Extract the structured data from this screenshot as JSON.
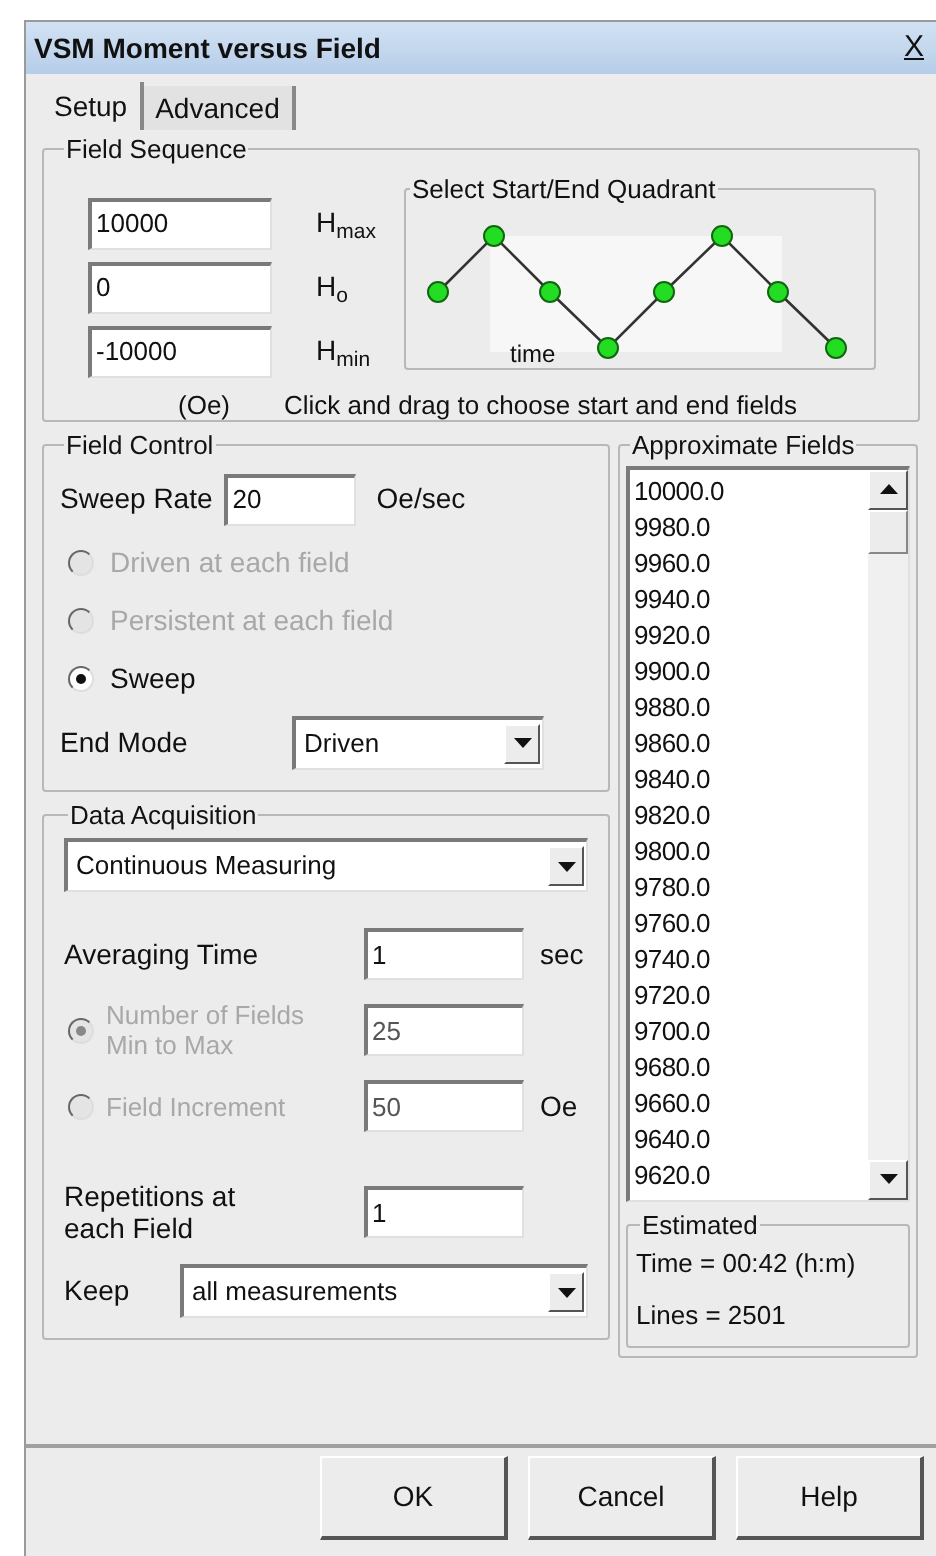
{
  "window": {
    "title": "VSM Moment versus Field",
    "close": "X"
  },
  "tabs": [
    {
      "label": "Setup",
      "selected": true
    },
    {
      "label": "Advanced",
      "selected": false
    }
  ],
  "field_sequence": {
    "title": "Field Sequence",
    "fields": [
      {
        "value": "10000",
        "label": "H$_{max}$"
      },
      {
        "value": "0",
        "label": "H$_{o}$"
      },
      {
        "value": "-10000",
        "label": "H$_{min}$"
      }
    ],
    "units": "(Oe)",
    "quadrant": {
      "title": "Select Start/End Quadrant",
      "axis_label": "time"
    },
    "hint": "Click and drag to choose start and end fields"
  },
  "field_control": {
    "title": "Field Control",
    "sweep_rate": {
      "label": "Sweep Rate",
      "value": "20",
      "unit": "Oe/sec"
    },
    "modes": [
      {
        "label": "Driven at each field",
        "selected": false,
        "disabled": true
      },
      {
        "label": "Persistent at each field",
        "selected": false,
        "disabled": true
      },
      {
        "label": "Sweep",
        "selected": true,
        "disabled": false
      }
    ],
    "end_mode": {
      "label": "End Mode",
      "value": "Driven"
    }
  },
  "data_acquisition": {
    "title": "Data Acquisition",
    "method": "Continuous Measuring",
    "averaging_time": {
      "label": "Averaging Time",
      "value": "1",
      "unit": "sec"
    },
    "spacing": [
      {
        "label": "Number of Fields Min to Max",
        "value": "25",
        "selected": true,
        "disabled": true
      },
      {
        "label": "Field Increment",
        "value": "50",
        "unit": "Oe",
        "selected": false,
        "disabled": true
      }
    ],
    "repetitions": {
      "label": "Repetitions at each Field",
      "value": "1"
    },
    "keep": {
      "label": "Keep",
      "value": "all measurements"
    }
  },
  "approximate_fields": {
    "title": "Approximate Fields",
    "values": [
      "10000.0",
      "9980.0",
      "9960.0",
      "9940.0",
      "9920.0",
      "9900.0",
      "9880.0",
      "9860.0",
      "9840.0",
      "9820.0",
      "9800.0",
      "9780.0",
      "9760.0",
      "9740.0",
      "9720.0",
      "9700.0",
      "9680.0",
      "9660.0",
      "9640.0",
      "9620.0"
    ]
  },
  "estimated": {
    "title": "Estimated",
    "lines": [
      "Time = 00:42 (h:m)",
      "Lines = 2501"
    ]
  },
  "buttons": [
    "OK",
    "Cancel",
    "Help"
  ]
}
